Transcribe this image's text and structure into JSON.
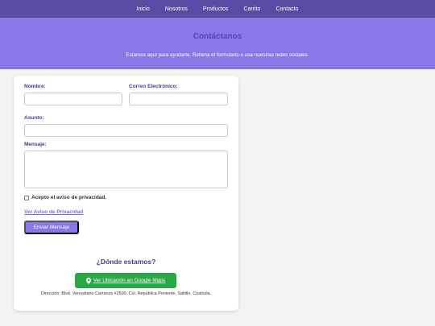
{
  "nav": {
    "items": [
      "Inicio",
      "Nosotros",
      "Productos",
      "Carrito",
      "Contacto"
    ]
  },
  "hero": {
    "title": "Contáctanos",
    "subtitle": "Estamos aquí para ayudarte. Rellena el formulario o usa nuestras redes sociales."
  },
  "form": {
    "name_label": "Nombre:",
    "name_value": "",
    "email_label": "Correo Electrónico:",
    "email_value": "",
    "subject_label": "Asunto:",
    "subject_value": "",
    "message_label": "Mensaje:",
    "message_value": "",
    "privacy_check_label": "Acepto el aviso de privacidad.",
    "privacy_checked": false,
    "privacy_link": "Ver Aviso de Privacidad",
    "submit_label": "Enviar Mensaje"
  },
  "location": {
    "title": "¿Dónde estamos?",
    "maps_button_label": "Ver Ubicación en Google Maps",
    "address": "Dirección: Blvd. Venustiano Carranza #2500, Col. República Poniente, Saltillo, Coahuila."
  },
  "colors": {
    "nav_bg": "#5b4aa3",
    "hero_bg": "#8b76e6",
    "accent": "#4a3a8c",
    "button_purple": "#8b76e6",
    "button_green": "#28a745"
  },
  "icons": {
    "maps_button": "map-pin-icon"
  }
}
